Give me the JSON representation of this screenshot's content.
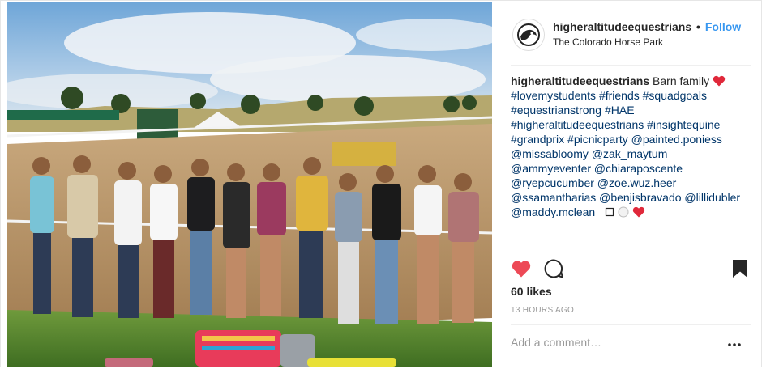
{
  "post": {
    "username": "higheraltitudeequestrians",
    "separator": "•",
    "follow_label": "Follow",
    "location": "The Colorado Horse Park",
    "caption_username": "higheraltitudeequestrians",
    "caption_text": "Barn family",
    "caption_emoji_icon": "red-heart-icon",
    "caption_lines": [
      "#lovemystudents #friends #squadgoals",
      "#equestrianstrong #HAE",
      "#higheraltitudeequestrians #insightequine",
      "#grandprix #picnicparty @painted.poniess",
      "@missabloomy @zak_maytum",
      "@ammyeventer @chiaraposcente",
      "@ryepcucumber @zoe.wuz.heer",
      "@ssamantharias @benjisbravado @lillidubler",
      "@maddy.mclean_"
    ],
    "last_line_icons": [
      "box-glyph-icon",
      "white-circle-icon",
      "red-heart-icon"
    ],
    "likes": "60 likes",
    "timestamp": "13 HOURS AGO",
    "comment_placeholder": "Add a comment…",
    "icons": {
      "like": "heart-filled-icon",
      "comment": "comment-bubble-icon",
      "save": "bookmark-icon",
      "more": "more-options-icon"
    },
    "colors": {
      "follow": "#3897f0",
      "heart": "#ed4956",
      "hashtag": "#003569",
      "muted": "#999999"
    }
  }
}
